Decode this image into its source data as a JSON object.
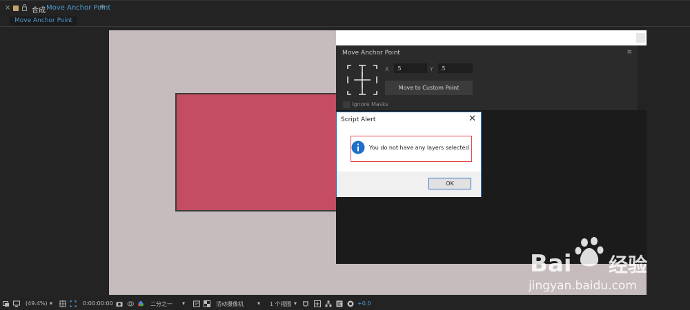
{
  "window": {
    "tab_close": "×",
    "comp_prefix": "合成",
    "comp_name": "Move Anchor Point",
    "menu_glyph": "≡",
    "subtab_label": "Move Anchor Point"
  },
  "colors": {
    "canvas_bg": "#c7bcbd",
    "layer_fill": "#c44c63",
    "accent_blue": "#4d9bd4",
    "dialog_border": "#2a74c4",
    "highlight_red": "#e04545"
  },
  "panel": {
    "title": "Move Anchor Point",
    "menu_glyph": "≡",
    "x_label": "X",
    "x_value": ".5",
    "y_label": "Y",
    "y_value": ".5",
    "move_button": "Move to Custom Point",
    "ignore_masks_label": "Ignore Masks"
  },
  "dialog": {
    "title": "Script Alert",
    "close_glyph": "✕",
    "message": "You do not have any layers selected",
    "ok_label": "OK"
  },
  "watermark": {
    "line1": "Bai",
    "line1_b": "经验",
    "line2": "jingyan.baidu.com"
  },
  "bottom_toolbar": {
    "zoom": "(49.4%)",
    "timecode": "0:00:00:00",
    "resolution": "二分之一",
    "camera": "活动摄像机",
    "views": "1 个视图",
    "exposure": "+0.0"
  }
}
